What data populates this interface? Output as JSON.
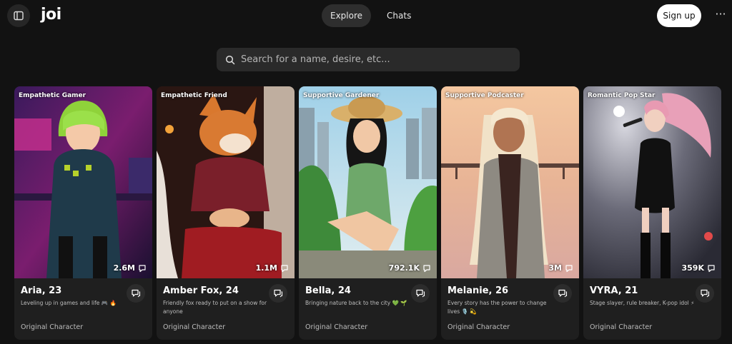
{
  "app": {
    "logo": "joi"
  },
  "header": {
    "tabs": [
      {
        "label": "Explore",
        "active": true
      },
      {
        "label": "Chats",
        "active": false
      }
    ],
    "signup_label": "Sign up",
    "more_label": "···"
  },
  "search": {
    "placeholder": "Search for a name, desire, etc..."
  },
  "cards": [
    {
      "category": "Empathetic Gamer",
      "count": "2.6M",
      "name": "Aria, 23",
      "description": "Leveling up in games and life 🎮 🔥",
      "type": "Original Character"
    },
    {
      "category": "Empathetic Friend",
      "count": "1.1M",
      "name": "Amber Fox, 24",
      "description": "Friendly fox ready to put on a show for anyone",
      "type": "Original Character"
    },
    {
      "category": "Supportive Gardener",
      "count": "792.1K",
      "name": "Bella, 24",
      "description": "Bringing nature back to the city 💚 🌱",
      "type": "Original Character"
    },
    {
      "category": "Supportive Podcaster",
      "count": "3M",
      "name": "Melanie, 26",
      "description": "Every story has the power to change lives 🎙️ 💫",
      "type": "Original Character"
    },
    {
      "category": "Romantic Pop Star",
      "count": "359K",
      "name": "VYRA, 21",
      "description": "Stage slayer, rule breaker, K-pop idol ⚡",
      "type": "Original Character"
    }
  ],
  "colors": {
    "background": "#121212",
    "card": "#1f1f1f",
    "surface": "#2a2a2a"
  }
}
